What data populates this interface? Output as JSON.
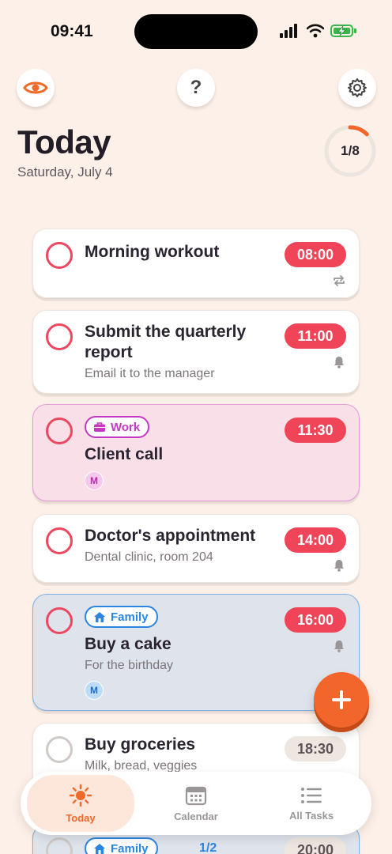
{
  "status_bar": {
    "time": "09:41"
  },
  "header": {
    "title": "Today",
    "date": "Saturday, July 4",
    "help_label": "?",
    "progress_text": "1/8",
    "progress_fraction": 0.125
  },
  "tasks": [
    {
      "title": "Morning workout",
      "subtitle": "",
      "time": "08:00",
      "indicator": "repeat-icon"
    },
    {
      "title": "Submit the quarterly report",
      "subtitle": "Email it to the manager",
      "time": "11:00",
      "indicator": "bell-icon"
    },
    {
      "title": "Client call",
      "tag": "Work",
      "avatar": "M",
      "time": "11:30"
    },
    {
      "title": "Doctor's appointment",
      "subtitle": "Dental clinic, room 204",
      "time": "14:00",
      "indicator": "bell-icon"
    },
    {
      "title": "Buy a cake",
      "subtitle": "For the birthday",
      "tag": "Family",
      "avatar": "M",
      "time": "16:00",
      "indicator": "bell-icon"
    },
    {
      "title": "Buy groceries",
      "subtitle": "Milk, bread, veggies",
      "time": "18:30"
    },
    {
      "tag": "Family",
      "count": "1/2",
      "time": "20:00"
    }
  ],
  "tab_bar": {
    "today": "Today",
    "calendar": "Calendar",
    "all_tasks": "All Tasks"
  },
  "colors": {
    "accent": "#f2662b",
    "danger": "#f04459",
    "work": "#c438c4",
    "family": "#2a86e0",
    "background": "#fdf0e8"
  }
}
